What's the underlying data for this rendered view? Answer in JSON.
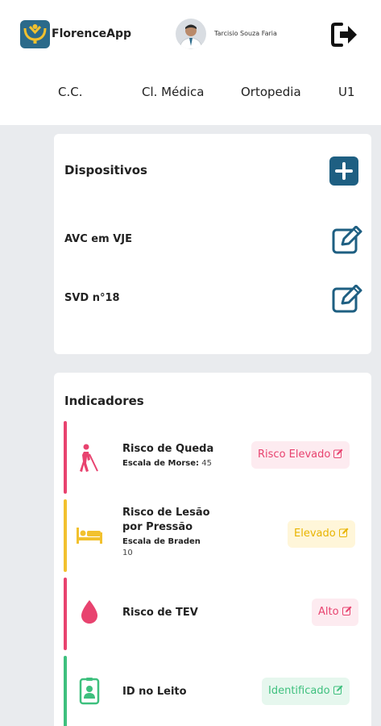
{
  "header": {
    "app_name": "FlorenceApp",
    "user_name": "Tarcisio Souza Faria"
  },
  "tabs": [
    "C.C.",
    "Cl. Médica",
    "Ortopedia",
    "U1"
  ],
  "devices": {
    "title": "Dispositivos",
    "items": [
      "AVC em VJE",
      "SVD n°18"
    ]
  },
  "indicators": {
    "title": "Indicadores",
    "items": [
      {
        "title": "Risco de Queda",
        "scale": "Escala de Morse:",
        "score": "45",
        "badge": "Risco Elevado",
        "color": "#e8436f",
        "icon": "walking-cane-icon"
      },
      {
        "title": "Risco de Lesão por Pressão",
        "scale": "Escala de Braden",
        "score": "10",
        "badge": "Elevado",
        "color": "#f2c12e",
        "icon": "bed-icon"
      },
      {
        "title": "Risco de TEV",
        "scale": "",
        "score": "",
        "badge": "Alto",
        "color": "#e8436f",
        "icon": "blood-drop-icon"
      },
      {
        "title": "ID no Leito",
        "scale": "",
        "score": "",
        "badge": "Identificado",
        "color": "#3ec07e",
        "icon": "id-badge-icon"
      }
    ]
  },
  "colors": {
    "primary": "#1e5f82",
    "danger": "#e8436f",
    "warning": "#f2c12e",
    "success": "#3ec07e"
  }
}
